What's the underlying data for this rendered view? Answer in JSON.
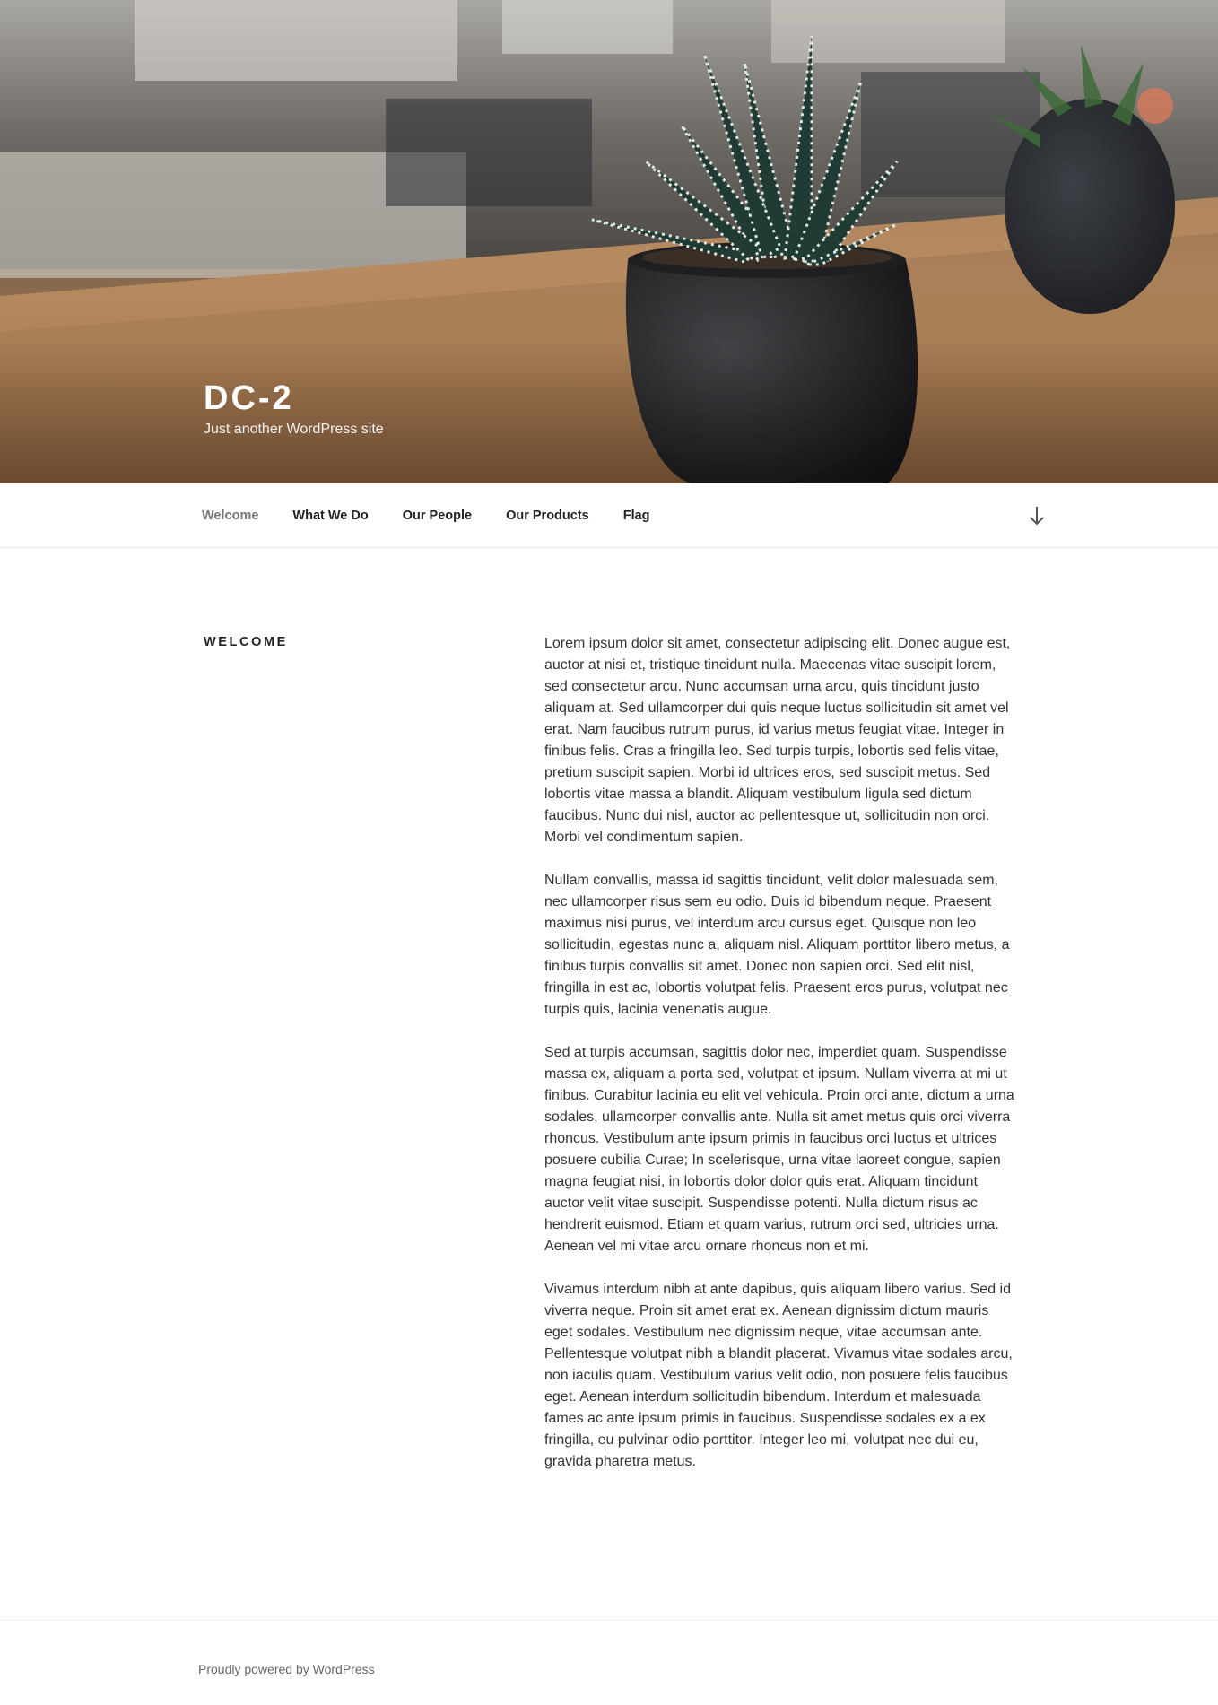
{
  "header": {
    "site_title": "DC-2",
    "site_description": "Just another WordPress site"
  },
  "nav": {
    "items": [
      {
        "label": "Welcome",
        "current": true
      },
      {
        "label": "What We Do"
      },
      {
        "label": "Our People"
      },
      {
        "label": "Our Products"
      },
      {
        "label": "Flag"
      }
    ],
    "scroll_icon": "arrow-down-icon"
  },
  "post": {
    "title": "WELCOME",
    "paragraphs": [
      "Lorem ipsum dolor sit amet, consectetur adipiscing elit. Donec augue est, auctor at nisi et, tristique tincidunt nulla. Maecenas vitae suscipit lorem, sed consectetur arcu. Nunc accumsan urna arcu, quis tincidunt justo aliquam at. Sed ullamcorper dui quis neque luctus sollicitudin sit amet vel erat. Nam faucibus rutrum purus, id varius metus feugiat vitae. Integer in finibus felis. Cras a fringilla leo. Sed turpis turpis, lobortis sed felis vitae, pretium suscipit sapien. Morbi id ultrices eros, sed suscipit metus. Sed lobortis vitae massa a blandit. Aliquam vestibulum ligula sed dictum faucibus. Nunc dui nisl, auctor ac pellentesque ut, sollicitudin non orci. Morbi vel condimentum sapien.",
      "Nullam convallis, massa id sagittis tincidunt, velit dolor malesuada sem, nec ullamcorper risus sem eu odio. Duis id bibendum neque. Praesent maximus nisi purus, vel interdum arcu cursus eget. Quisque non leo sollicitudin, egestas nunc a, aliquam nisl. Aliquam porttitor libero metus, a finibus turpis convallis sit amet. Donec non sapien orci. Sed elit nisl, fringilla in est ac, lobortis volutpat felis. Praesent eros purus, volutpat nec turpis quis, lacinia venenatis augue.",
      "Sed at turpis accumsan, sagittis dolor nec, imperdiet quam. Suspendisse massa ex, aliquam a porta sed, volutpat et ipsum. Nullam viverra at mi ut finibus. Curabitur lacinia eu elit vel vehicula. Proin orci ante, dictum a urna sodales, ullamcorper convallis ante. Nulla sit amet metus quis orci viverra rhoncus. Vestibulum ante ipsum primis in faucibus orci luctus et ultrices posuere cubilia Curae; In scelerisque, urna vitae laoreet congue, sapien magna feugiat nisi, in lobortis dolor dolor quis erat. Aliquam tincidunt auctor velit vitae suscipit. Suspendisse potenti. Nulla dictum risus ac hendrerit euismod. Etiam et quam varius, rutrum orci sed, ultricies urna. Aenean vel mi vitae arcu ornare rhoncus non et mi.",
      "Vivamus interdum nibh at ante dapibus, quis aliquam libero varius. Sed id viverra neque. Proin sit amet erat ex. Aenean dignissim dictum mauris eget sodales. Vestibulum nec dignissim neque, vitae accumsan ante. Pellentesque volutpat nibh a blandit placerat. Vivamus vitae sodales arcu, non iaculis quam. Vestibulum varius velit odio, non posuere felis faucibus eget. Aenean interdum sollicitudin bibendum. Interdum et malesuada fames ac ante ipsum primis in faucibus. Suspendisse sodales ex a ex fringilla, eu pulvinar odio porttitor. Integer leo mi, volutpat nec dui eu, gravida pharetra metus."
    ]
  },
  "footer": {
    "site_info": "Proudly powered by WordPress"
  },
  "colors": {
    "text": "#333333",
    "heading": "#222222",
    "nav_current": "#767676",
    "border": "#eeeeee"
  }
}
